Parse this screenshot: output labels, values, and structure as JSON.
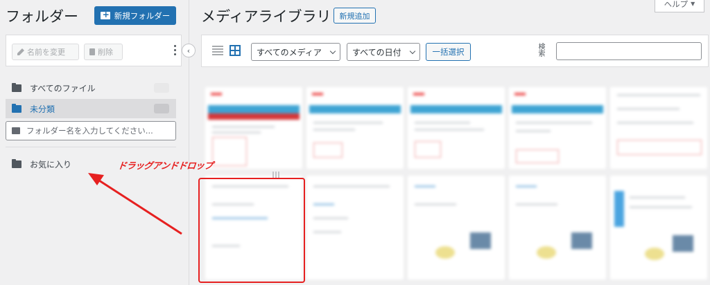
{
  "sidebar": {
    "title": "フォルダー",
    "new_folder_button": "新規フォルダー",
    "toolbar": {
      "rename_label": "名前を変更",
      "delete_label": "削除"
    },
    "folders": {
      "all_files": "すべてのファイル",
      "uncategorized": "未分類",
      "favorites": "お気に入り"
    },
    "search_placeholder": "フォルダー名を入力してください..."
  },
  "main": {
    "title": "メディアライブラリ",
    "add_new_button": "新規追加",
    "help_label": "ヘルプ",
    "help_arrow": "▼",
    "filters": {
      "media_type": "すべてのメディア",
      "date": "すべての日付",
      "bulk_select": "一括選択",
      "search_label": "検索"
    }
  },
  "annotation": {
    "label": "ドラッグアンドドロップ",
    "color": "#e62020"
  },
  "colors": {
    "accent": "#2271b1",
    "background": "#f0f0f1"
  }
}
